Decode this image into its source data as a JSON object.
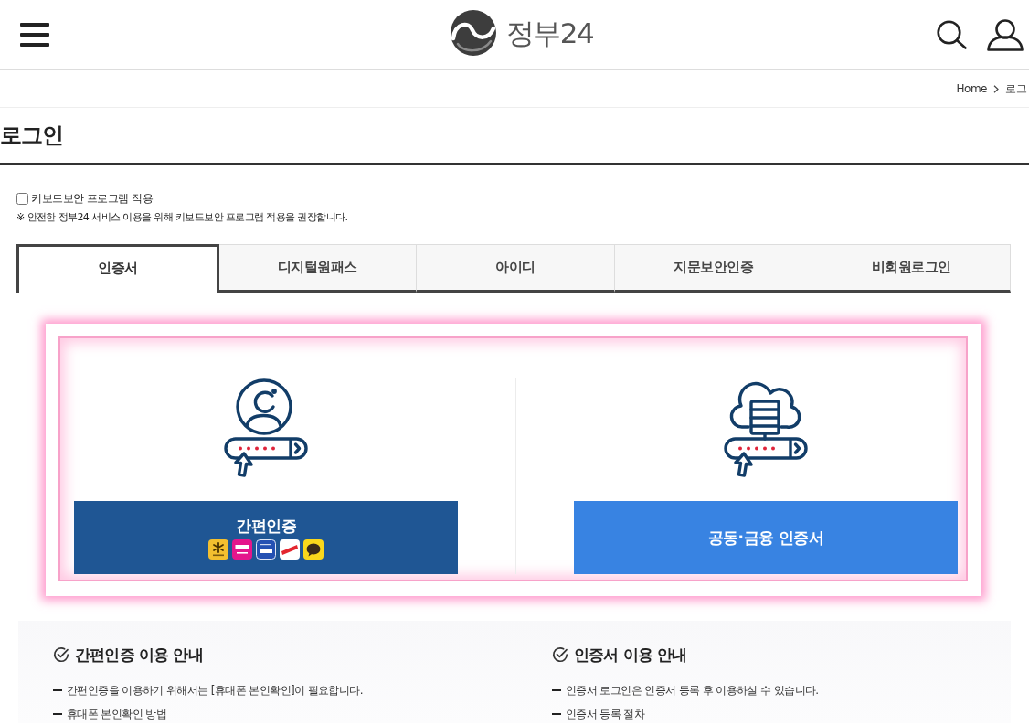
{
  "header": {
    "logo_text": "정부24"
  },
  "breadcrumb": [
    "Home",
    "로그"
  ],
  "page_title": "로그인",
  "keyboard_security": {
    "label": "키보드보안 프로그램 적용",
    "checked": false
  },
  "notice": "※ 안전한 정부24 서비스 이용을 위해 키보드보안 프로그램 적용을 권장합니다.",
  "tabs": [
    {
      "label": "인증서",
      "selected": true
    },
    {
      "label": "디지털원패스",
      "selected": false
    },
    {
      "label": "아이디",
      "selected": false
    },
    {
      "label": "지문보안인증",
      "selected": false
    },
    {
      "label": "비회원로그인",
      "selected": false
    }
  ],
  "login_options": [
    {
      "kind": "simple",
      "label": "간편인증"
    },
    {
      "kind": "certificate",
      "label": "공동·금융 인증서"
    }
  ],
  "guides": [
    {
      "title": "간편인증 이용 안내",
      "items": [
        "간편인증을 이용하기 위해서는 [휴대폰 본인확인]이 필요합니다.",
        "휴대폰 본인확인 방법"
      ]
    },
    {
      "title": "인증서 이용 안내",
      "items": [
        "인증서 로그인은 인증서 등록 후 이용하실 수 있습니다.",
        "인증서 등록 절차"
      ]
    }
  ]
}
